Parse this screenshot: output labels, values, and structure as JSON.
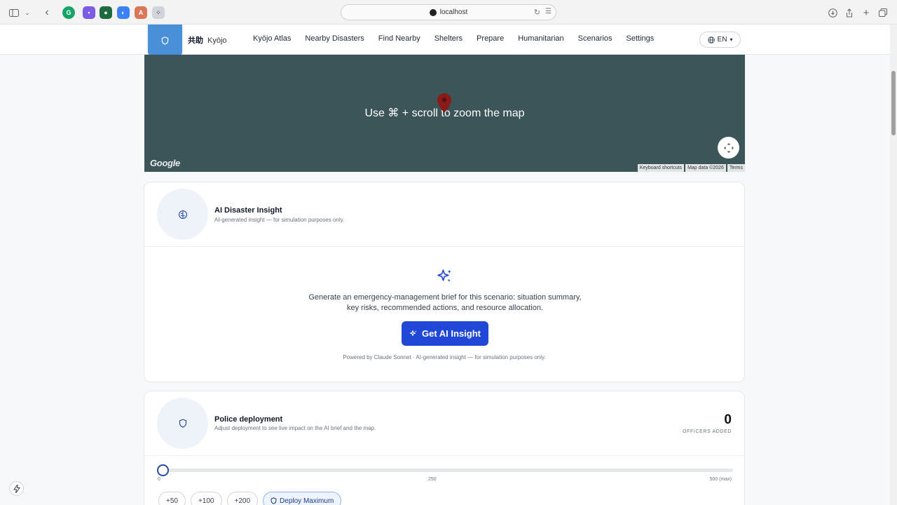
{
  "browser": {
    "url": "localhost"
  },
  "nav": {
    "brand_kanji": "共助",
    "brand_name": "Kyōjo",
    "links": [
      "Kyōjo Atlas",
      "Nearby Disasters",
      "Find Nearby",
      "Shelters",
      "Prepare",
      "Humanitarian",
      "Scenarios",
      "Settings"
    ],
    "language": "EN"
  },
  "map": {
    "zoom_hint": "Use ⌘ + scroll to zoom the map",
    "logo_text": "Google",
    "attribution": [
      "Keyboard shortcuts",
      "Map data ©2026",
      "Terms"
    ]
  },
  "insight": {
    "title": "AI Disaster Insight",
    "subtitle": "AI-generated insight — for simulation purposes only.",
    "description": "Generate an emergency-management brief for this scenario: situation summary, key risks, recommended actions, and resource allocation.",
    "button_label": "Get AI Insight",
    "powered_by": "Powered by Claude Sonnet · AI-generated insight — for simulation purposes only."
  },
  "police": {
    "title": "Police deployment",
    "subtitle": "Adjust deployment to see live impact on the AI brief and the map.",
    "officers_count": "0",
    "officers_label": "OFFICERS ADDED",
    "slider": {
      "value": 0,
      "min": 0,
      "max": 500,
      "tick_min": "0",
      "tick_mid": "250",
      "tick_max": "500 (max)"
    },
    "chips": [
      "+50",
      "+100",
      "+200"
    ],
    "deploy_max_label": "Deploy Maximum"
  },
  "colors": {
    "primary": "#2047d5",
    "map_bg": "#3b5558",
    "logo_bg": "#4a90d9"
  }
}
